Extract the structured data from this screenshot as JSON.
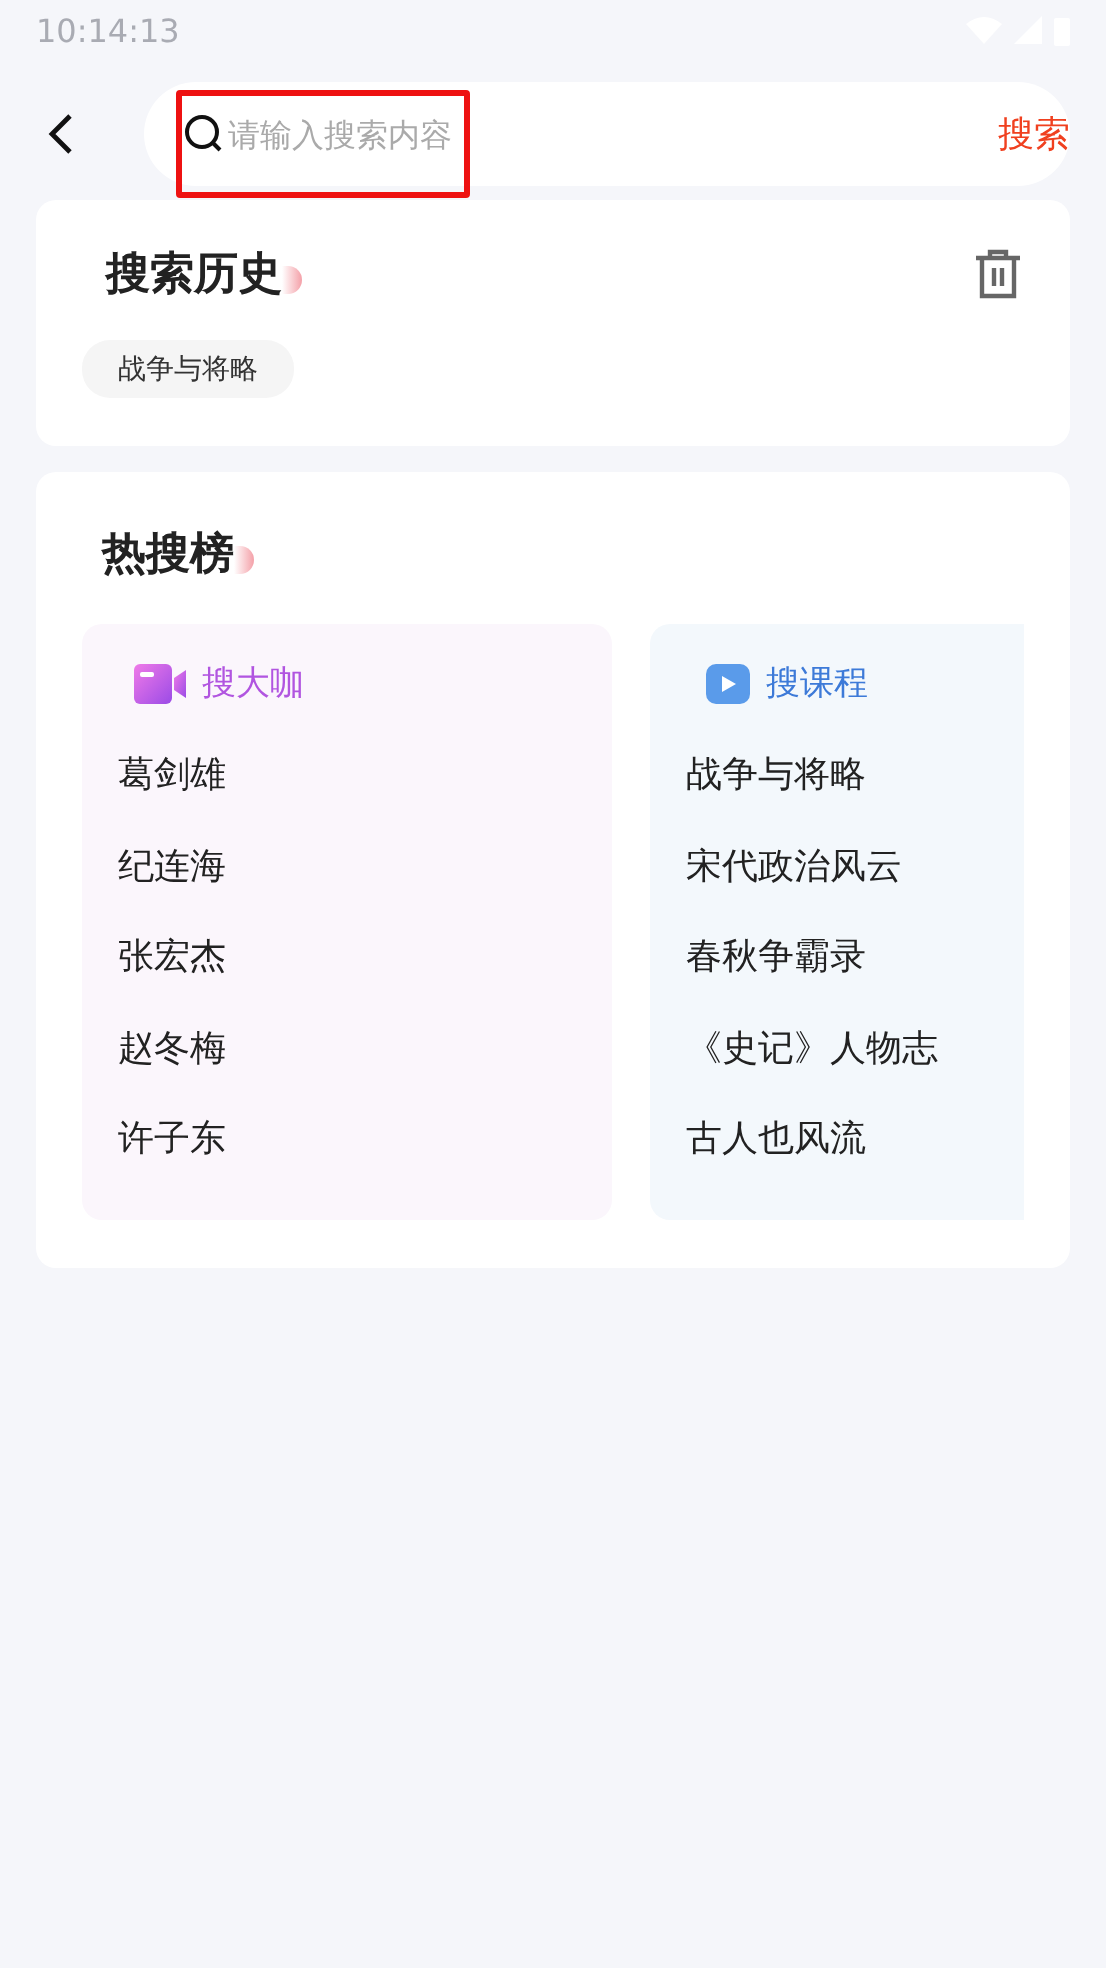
{
  "status_bar": {
    "time": "10:14:13"
  },
  "search": {
    "placeholder": "请输入搜索内容",
    "button": "搜索",
    "highlighted": true
  },
  "history": {
    "title": "搜索历史",
    "tags": [
      "战争与将略"
    ]
  },
  "hot": {
    "title": "热搜榜",
    "panels": [
      {
        "kind": "people",
        "title": "搜大咖",
        "items": [
          "葛剑雄",
          "纪连海",
          "张宏杰",
          "赵冬梅",
          "许子东"
        ]
      },
      {
        "kind": "courses",
        "title": "搜课程",
        "items": [
          "战争与将略",
          "宋代政治风云",
          "春秋争霸录",
          "《史记》人物志",
          "古人也风流"
        ]
      }
    ]
  }
}
